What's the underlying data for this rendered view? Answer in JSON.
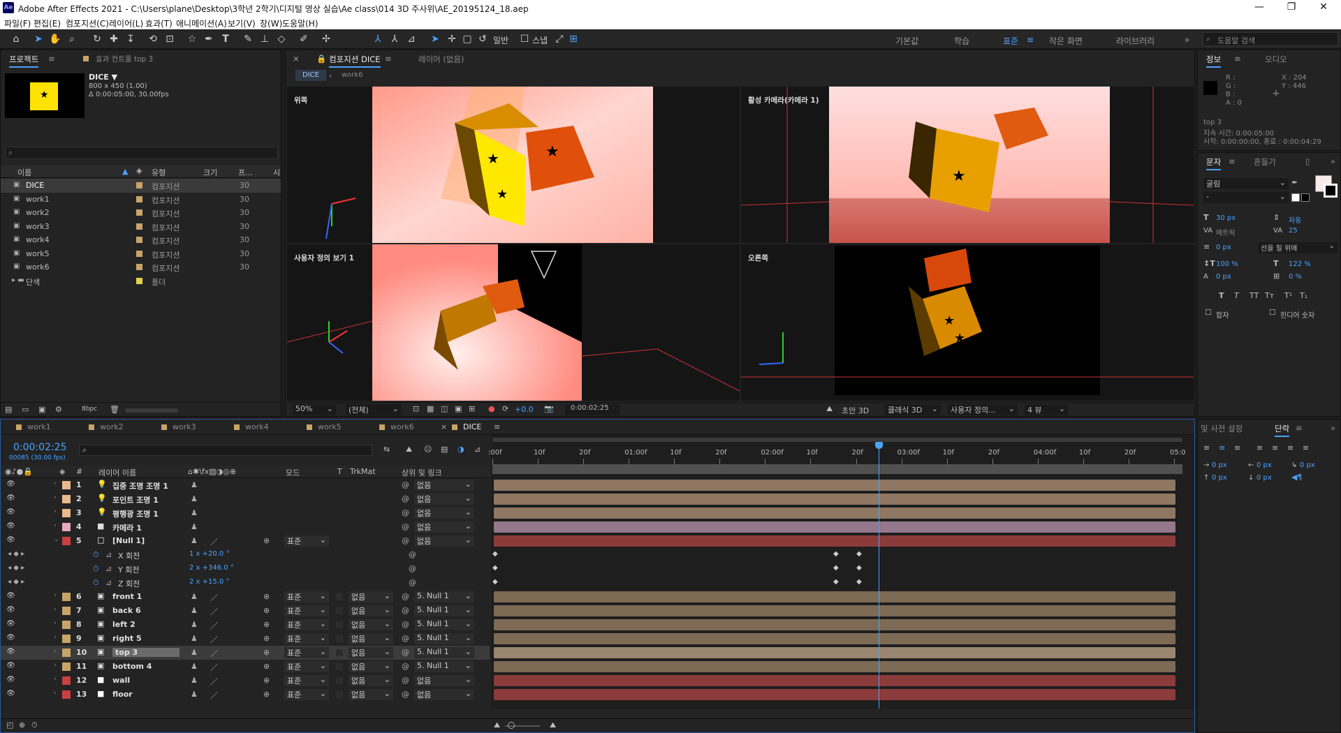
{
  "titlebar": {
    "app_icon": "Ae",
    "title": "Adobe After Effects 2021 - C:\\Users\\plane\\Desktop\\3학년 2학기\\디지털 영상 실습\\Ae class\\014 3D 주사위\\AE_20195124_18.aep"
  },
  "menu": [
    "파일(F)",
    "편집(E)",
    "컴포지션(C)",
    "레이어(L)",
    "효과(T)",
    "애니메이션(A)",
    "보기(V)",
    "창(W)",
    "도움말(H)"
  ],
  "workspaces": {
    "items": [
      "기본값",
      "학습",
      "표준",
      "작은 화면",
      "라이브러리"
    ],
    "active": "표준",
    "snap_label": "스냅",
    "align_label": "일반"
  },
  "help_search": {
    "placeholder": "도움말 검색"
  },
  "project": {
    "tab": "프로젝트",
    "tab2": "효과 컨트롤 top 3",
    "comp_name": "DICE ▼",
    "comp_size": "800 x 450 (1.00)",
    "comp_dur": "Δ 0:00:05:00, 30.00fps",
    "columns": [
      "이름",
      "유형",
      "크기",
      "프...",
      "시"
    ],
    "items": [
      {
        "name": "DICE",
        "type": "컴포지션",
        "fps": "30",
        "color": "#c8a468"
      },
      {
        "name": "work1",
        "type": "컴포지션",
        "fps": "30",
        "color": "#c8a468"
      },
      {
        "name": "work2",
        "type": "컴포지션",
        "fps": "30",
        "color": "#c8a468"
      },
      {
        "name": "work3",
        "type": "컴포지션",
        "fps": "30",
        "color": "#c8a468"
      },
      {
        "name": "work4",
        "type": "컴포지션",
        "fps": "30",
        "color": "#c8a468"
      },
      {
        "name": "work5",
        "type": "컴포지션",
        "fps": "30",
        "color": "#c8a468"
      },
      {
        "name": "work6",
        "type": "컴포지션",
        "fps": "30",
        "color": "#c8a468"
      },
      {
        "name": "단색",
        "type": "폴더",
        "fps": "",
        "color": "#e2d24a"
      }
    ],
    "bpc": "8bpc"
  },
  "comp_viewer": {
    "tab": "컴포지션 DICE",
    "layer_tab": "레이어 (없음)",
    "breadcrumbs": [
      "DICE",
      "work6"
    ],
    "views": [
      "위쪽",
      "활성 카메라(카메라 1)",
      "사용자 정의 보기 1",
      "오른쪽"
    ],
    "zoom": "50%",
    "resolution": "(전체)",
    "exposure": "+0.0",
    "timecode": "0:00:02:25",
    "draft": "초안 3D",
    "renderer": "클래식 3D",
    "view_select": "사용자 정의...",
    "view_layout": "4 뷰"
  },
  "info": {
    "tab": "정보",
    "tab2": "오디오",
    "r": "R :",
    "g": "G :",
    "b": "B :",
    "a": "A : 0",
    "x": "X : 204",
    "y": "Y : 446",
    "layer": "top 3",
    "duration": "지속 시간: 0:00:05:00",
    "range": "시작: 0:00:00:00, 종료 : 0:00:04:29"
  },
  "character": {
    "tab": "문자",
    "tab2": "흔들기",
    "font": "굴림",
    "style": "-",
    "size": "30 px",
    "leading": "자동",
    "tracking_label": "메트릭",
    "tracking": "25",
    "stroke": "0 px",
    "stroke_mode": "선을 칠 위에",
    "vscale": "100 %",
    "hscale": "122 %",
    "baseline": "0 px",
    "tsume": "0 %",
    "styles": [
      "T",
      "T",
      "TT",
      "Tт",
      "T¹",
      "T₁"
    ],
    "ligature": "합자",
    "hindi": "힌디어 숫자"
  },
  "paragraph": {
    "tab": "단락",
    "tab2": "및 사전 설정",
    "indent": [
      "0 px",
      "0 px",
      "0 px",
      "0 px",
      "0 px"
    ]
  },
  "timeline": {
    "tabs": [
      "work1",
      "work2",
      "work3",
      "work4",
      "work5",
      "work6",
      "DICE"
    ],
    "active_tab": "DICE",
    "timecode": "0:00:02:25",
    "frames": "00085 (30.00 fps)",
    "headers": {
      "name": "레이어 이름",
      "mode": "모드",
      "t": "T",
      "trkmat": "TrkMat",
      "parent": "상위 및 링크"
    },
    "ruler": [
      ":00f",
      "10f",
      "20f",
      "01:00f",
      "10f",
      "20f",
      "02:00f",
      "10f",
      "20f",
      "03:00f",
      "10f",
      "20f",
      "04:00f",
      "10f",
      "20f",
      "05:0"
    ],
    "playhead_seconds": 2.833,
    "layers": [
      {
        "num": "1",
        "name": "집중 조명 조명 1",
        "color": "#e9b88c",
        "icon": "light-icon",
        "mode": "",
        "trk": "",
        "parent": "없음",
        "bar": "#8e7763"
      },
      {
        "num": "2",
        "name": "포인트 조명 1",
        "color": "#e9b88c",
        "icon": "light-icon",
        "mode": "",
        "trk": "",
        "parent": "없음",
        "bar": "#8e7763"
      },
      {
        "num": "3",
        "name": "평행광 조명 1",
        "color": "#e9b88c",
        "icon": "light-icon",
        "mode": "",
        "trk": "",
        "parent": "없음",
        "bar": "#8e7763"
      },
      {
        "num": "4",
        "name": "카메라 1",
        "color": "#e7a6c2",
        "icon": "camera-icon",
        "mode": "",
        "trk": "",
        "parent": "없음",
        "bar": "#94778a"
      },
      {
        "num": "5",
        "name": "[Null 1]",
        "color": "#c94040",
        "icon": "null-icon",
        "mode": "표준",
        "trk": "",
        "parent": "없음",
        "bar": "#8c3b3b"
      },
      {
        "num": "",
        "name": "X 회전",
        "prop": "1 x +20.0 °",
        "bar": ""
      },
      {
        "num": "",
        "name": "Y 회전",
        "prop": "2 x +346.0 °",
        "bar": ""
      },
      {
        "num": "",
        "name": "Z 회전",
        "prop": "2 x +15.0 °",
        "bar": ""
      },
      {
        "num": "6",
        "name": "front 1",
        "color": "#c8a468",
        "icon": "comp-icon",
        "mode": "표준",
        "trk": "없음",
        "parent": "5. Null 1",
        "bar": "#7d6a55"
      },
      {
        "num": "7",
        "name": "back 6",
        "color": "#c8a468",
        "icon": "comp-icon",
        "mode": "표준",
        "trk": "없음",
        "parent": "5. Null 1",
        "bar": "#7d6a55"
      },
      {
        "num": "8",
        "name": "left 2",
        "color": "#c8a468",
        "icon": "comp-icon",
        "mode": "표준",
        "trk": "없음",
        "parent": "5. Null 1",
        "bar": "#7d6a55"
      },
      {
        "num": "9",
        "name": "right 5",
        "color": "#c8a468",
        "icon": "comp-icon",
        "mode": "표준",
        "trk": "없음",
        "parent": "5. Null 1",
        "bar": "#7d6a55"
      },
      {
        "num": "10",
        "name": "top 3",
        "color": "#c8a468",
        "icon": "comp-icon",
        "mode": "표준",
        "trk": "없음",
        "parent": "5. Null 1",
        "bar": "#9a8670",
        "selected": true
      },
      {
        "num": "11",
        "name": "bottom 4",
        "color": "#c8a468",
        "icon": "comp-icon",
        "mode": "표준",
        "trk": "없음",
        "parent": "5. Null 1",
        "bar": "#7d6a55"
      },
      {
        "num": "12",
        "name": "wall",
        "color": "#c94040",
        "icon": "solid-icon",
        "mode": "표준",
        "trk": "없음",
        "parent": "없음",
        "bar": "#8c3b3b"
      },
      {
        "num": "13",
        "name": "floor",
        "color": "#c94040",
        "icon": "solid-icon",
        "mode": "표준",
        "trk": "없음",
        "parent": "없음",
        "bar": "#8c3b3b"
      }
    ]
  }
}
